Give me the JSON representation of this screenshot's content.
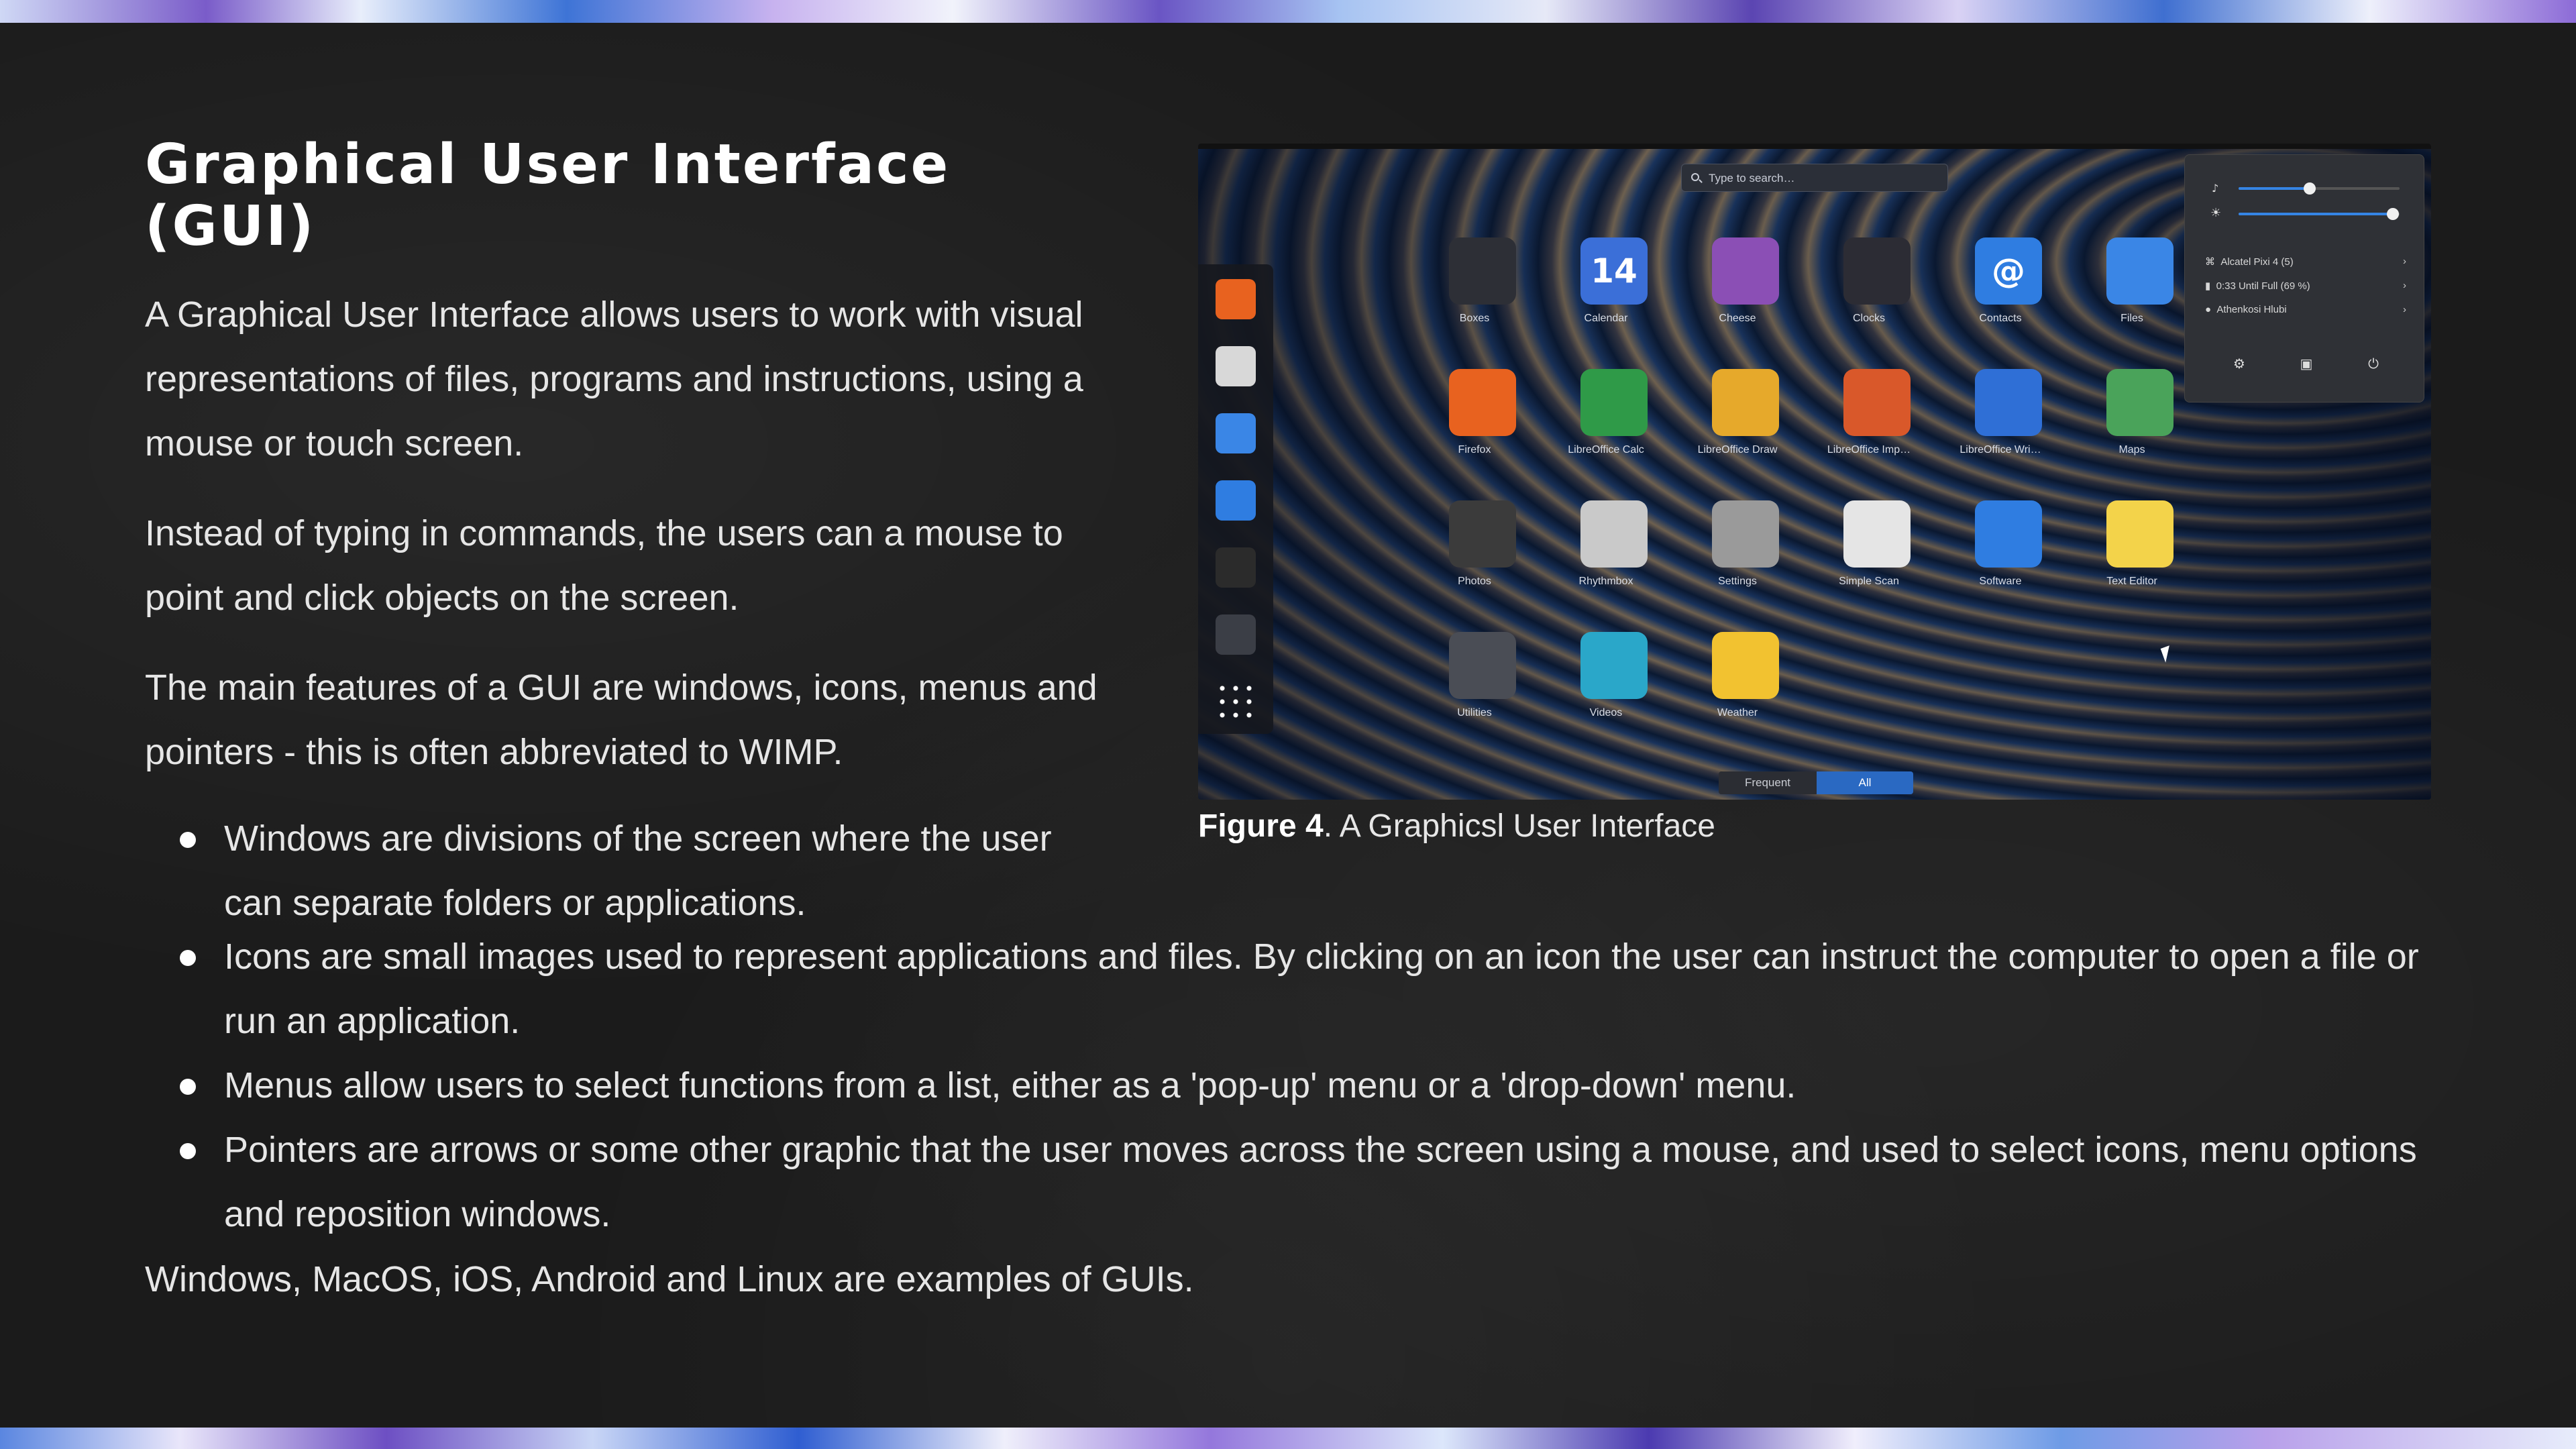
{
  "slide": {
    "title": "Graphical User Interface (GUI)",
    "paragraphs": [
      "A Graphical User Interface allows users to work with visual representations of files, programs and instructions, using a mouse or touch screen.",
      "Instead of typing in commands, the users can a mouse to point and click objects on the screen.",
      "The main features of a GUI are windows, icons, menus and pointers - this is often abbreviated to WIMP."
    ],
    "bullets": [
      "Windows are divisions of the screen where the user can separate folders or applications.",
      "Icons are small images used to represent applications and files. By clicking on an icon the user can instruct the computer to open a file or run an application.",
      "Menus allow users to select functions from a list, either as a 'pop-up' menu or a 'drop-down' menu.",
      "Pointers are arrows or some other graphic that the user moves across the screen using a mouse, and used to select icons, menu options and reposition windows."
    ],
    "closing": "Windows, MacOS, iOS, Android and Linux are examples of GUIs."
  },
  "figure": {
    "caption_label": "Figure 4",
    "caption_text": ". A Graphicsl User Interface",
    "search_placeholder": "Type to search…",
    "dock_icons": [
      "firefox-icon",
      "rhythmbox-icon",
      "files-icon",
      "software-icon",
      "terminal-icon",
      "system-monitor-icon",
      "app-grid-icon"
    ],
    "apps": [
      {
        "label": "Boxes",
        "icon": "boxes-icon",
        "color": "#2d2f36"
      },
      {
        "label": "Calendar",
        "icon": "calendar-icon",
        "color": "#3b6fd8",
        "text": "14"
      },
      {
        "label": "Cheese",
        "icon": "cheese-icon",
        "color": "#8b4fb5"
      },
      {
        "label": "Clocks",
        "icon": "clocks-icon",
        "color": "#2c2c34"
      },
      {
        "label": "Contacts",
        "icon": "contacts-icon",
        "color": "#2f7de1",
        "text": "@"
      },
      {
        "label": "Files",
        "icon": "files-icon",
        "color": "#3a86e6"
      },
      {
        "label": "Firefox",
        "icon": "firefox-icon",
        "color": "#e8621f"
      },
      {
        "label": "LibreOffice Calc",
        "icon": "libreoffice-calc-icon",
        "color": "#2f9a48"
      },
      {
        "label": "LibreOffice Draw",
        "icon": "libreoffice-draw-icon",
        "color": "#e6a92b"
      },
      {
        "label": "LibreOffice Imp…",
        "icon": "libreoffice-impress-icon",
        "color": "#d9582a"
      },
      {
        "label": "LibreOffice Wri…",
        "icon": "libreoffice-writer-icon",
        "color": "#2f6fd6"
      },
      {
        "label": "Maps",
        "icon": "maps-icon",
        "color": "#4aa35a"
      },
      {
        "label": "Photos",
        "icon": "photos-icon",
        "color": "#3b3b3b"
      },
      {
        "label": "Rhythmbox",
        "icon": "rhythmbox-icon",
        "color": "#c9c9c9"
      },
      {
        "label": "Settings",
        "icon": "settings-icon",
        "color": "#9a9a9a"
      },
      {
        "label": "Simple Scan",
        "icon": "simple-scan-icon",
        "color": "#e5e5e5"
      },
      {
        "label": "Software",
        "icon": "software-icon",
        "color": "#2f7de1"
      },
      {
        "label": "Text Editor",
        "icon": "text-editor-icon",
        "color": "#f3d34a"
      },
      {
        "label": "Utilities",
        "icon": "utilities-icon",
        "color": "#4a4d55"
      },
      {
        "label": "Videos",
        "icon": "videos-icon",
        "color": "#2aa7c9"
      },
      {
        "label": "Weather",
        "icon": "weather-icon",
        "color": "#f2c230"
      }
    ],
    "panel": {
      "volume_level": 0.44,
      "brightness_level": 0.96,
      "rows": [
        {
          "icon": "wifi-icon",
          "label": "Alcatel Pixi 4 (5)"
        },
        {
          "icon": "battery-icon",
          "label": "0:33 Until Full (69 %)"
        },
        {
          "icon": "user-icon",
          "label": "Athenkosi Hlubi"
        }
      ],
      "buttons": [
        "settings-icon",
        "lock-icon",
        "power-icon"
      ]
    },
    "tabs": {
      "frequent": "Frequent",
      "all": "All"
    }
  }
}
